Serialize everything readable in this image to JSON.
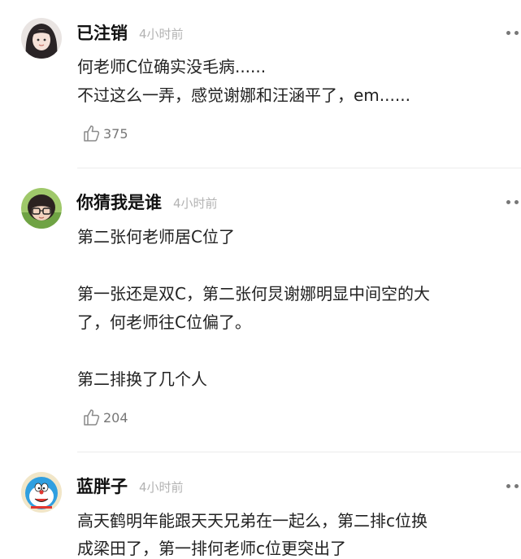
{
  "comments": [
    {
      "name": "已注销",
      "time": "4小时前",
      "avatar": "avatar-girl-long-hair",
      "lines": [
        "何老师C位确实没毛病......",
        "不过这么一弄，感觉谢娜和汪涵平了，em......"
      ],
      "likes": "375"
    },
    {
      "name": "你猜我是谁",
      "time": "4小时前",
      "avatar": "avatar-child-glasses",
      "lines": [
        "第二张何老师居C位了",
        "",
        "第一张还是双C，第二张何炅谢娜明显中间空的大",
        "了，何老师往C位偏了。",
        "",
        "第二排换了几个人"
      ],
      "likes": "204"
    },
    {
      "name": "蓝胖子",
      "time": "4小时前",
      "avatar": "avatar-doraemon",
      "lines": [
        "高天鹤明年能跟天天兄弟在一起么，第二排c位换",
        "成梁田了，第一排何老师c位更突出了"
      ],
      "likes": ""
    }
  ],
  "icons": {
    "like": "thumbs-up-icon",
    "more": "more-dots-icon"
  }
}
